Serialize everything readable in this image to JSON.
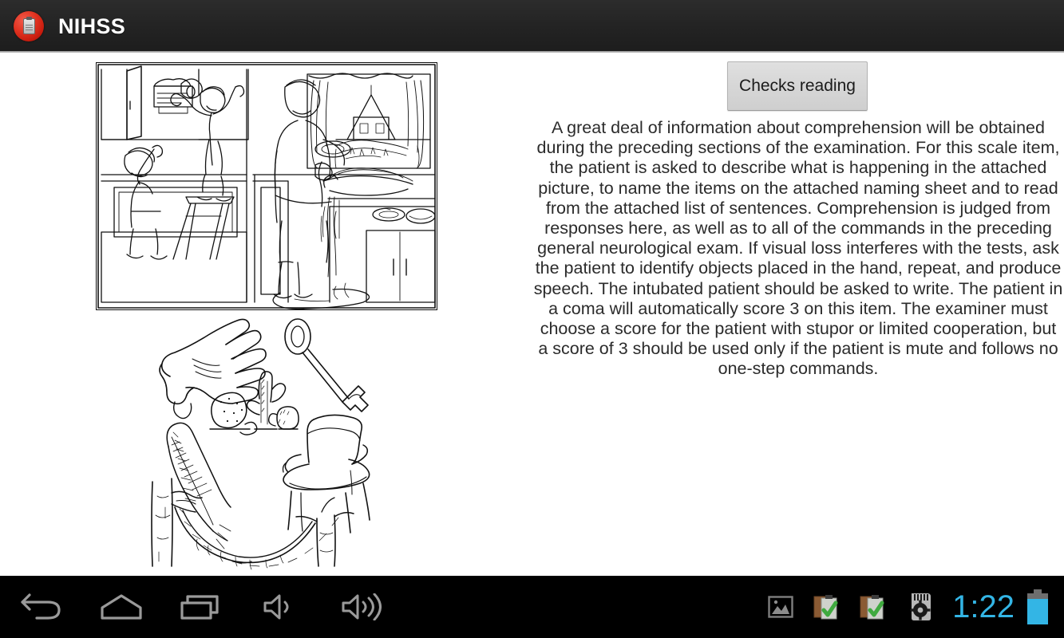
{
  "app": {
    "title": "NIHSS",
    "icon": "nihss-app-icon"
  },
  "main": {
    "section_button_label": "Checks reading",
    "description": "A great deal of information about comprehension will be obtained during the preceding sections of the examination. For this scale item, the patient is asked to describe what is happening in the attached picture, to name the items on the attached naming sheet and to read from the attached list of sentences. Comprehension is judged from responses here, as well as to all of the commands in the preceding general neurological exam. If visual loss interferes with the tests, ask the patient to identify objects placed in the hand, repeat, and produce speech. The intubated patient should be asked to write. The patient in a coma will automatically score 3 on this item. The examiner must choose a score for the patient with stupor or limited cooperation, but a score of 3 should be used only if the patient is mute and follows no one-step commands.",
    "images": {
      "kitchen_picture": "cookie-theft-kitchen-scene",
      "naming_sheet": "nihss-naming-sheet"
    }
  },
  "navbar": {
    "back_icon": "back-arrow-icon",
    "home_icon": "home-icon",
    "recents_icon": "recent-apps-icon",
    "volume_down_icon": "volume-down-icon",
    "volume_up_icon": "volume-up-icon",
    "status_icons": [
      "screenshot-image-icon",
      "clipboard-check-icon",
      "clipboard-check-icon",
      "sdcard-settings-icon"
    ],
    "clock": "1:22",
    "battery_icon": "battery-icon"
  },
  "colors": {
    "title_bar": "#232323",
    "nav_bar": "#000000",
    "clock_accent": "#33b5e5",
    "button_face": "#d7d7d7",
    "app_icon_red": "#e23422",
    "check_green": "#4caf50",
    "page_background": "#ffffff"
  }
}
